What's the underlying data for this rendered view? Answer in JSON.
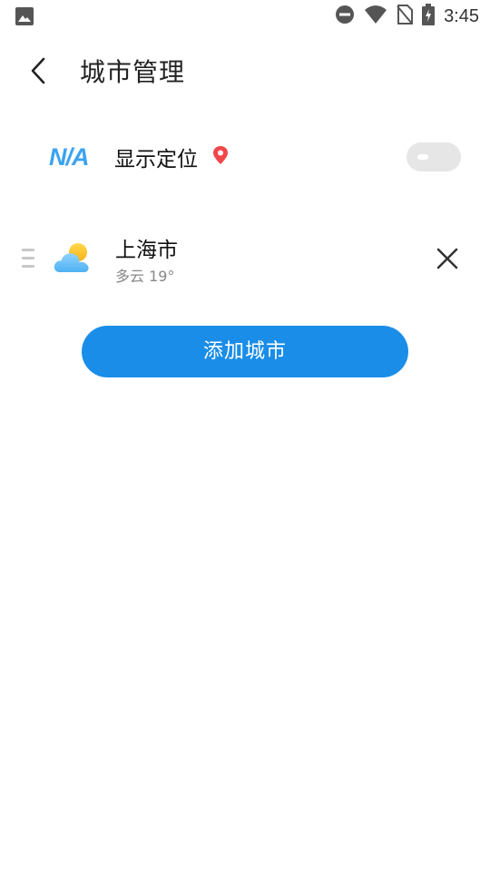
{
  "status_bar": {
    "time": "3:45",
    "icons": [
      "image-icon",
      "do-not-disturb-icon",
      "wifi-icon",
      "no-sim-icon",
      "battery-charging-icon"
    ]
  },
  "header": {
    "title": "城市管理",
    "back_icon": "back-arrow-icon"
  },
  "location": {
    "badge": "N/A",
    "label": "显示定位",
    "pin_icon": "location-pin-icon",
    "pin_color": "#f2474a",
    "toggle_on": false
  },
  "cities": [
    {
      "name": "上海市",
      "weather": "多云 19°",
      "icon": "partly-cloudy-icon"
    }
  ],
  "add_button": {
    "label": "添加城市"
  },
  "colors": {
    "accent": "#1a8de8",
    "badge": "#3aa3f0",
    "toggle_off": "#e6e6e6"
  }
}
